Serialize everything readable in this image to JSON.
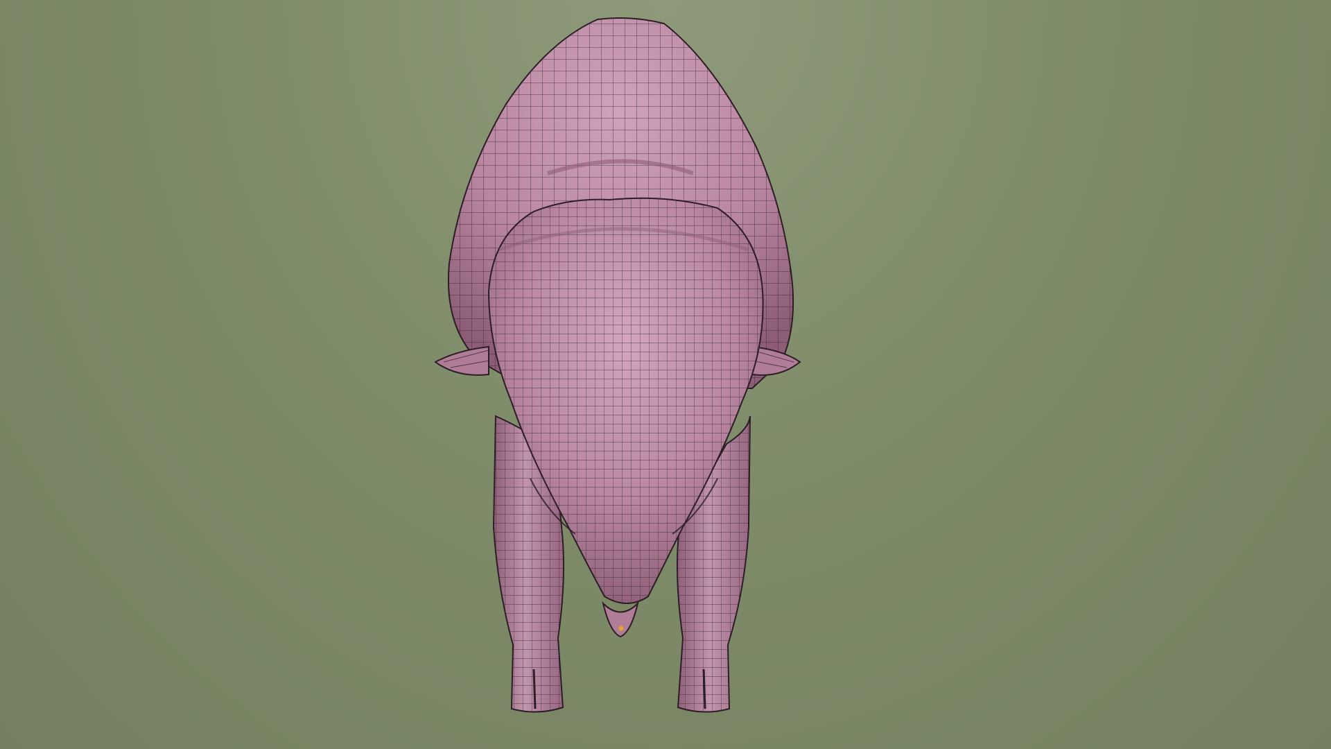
{
  "viewport": {
    "background_color": "#7f8c69",
    "background_top_color": "#8e9a7a"
  },
  "model": {
    "icon": "bison-wireframe-mesh",
    "surface_color": "#b9869f",
    "surface_light_color": "#cfa3ba",
    "surface_shadow_color": "#8c5d75",
    "wire_color": "#2c1d27",
    "selected_vertex_color": "#e8a12a"
  }
}
